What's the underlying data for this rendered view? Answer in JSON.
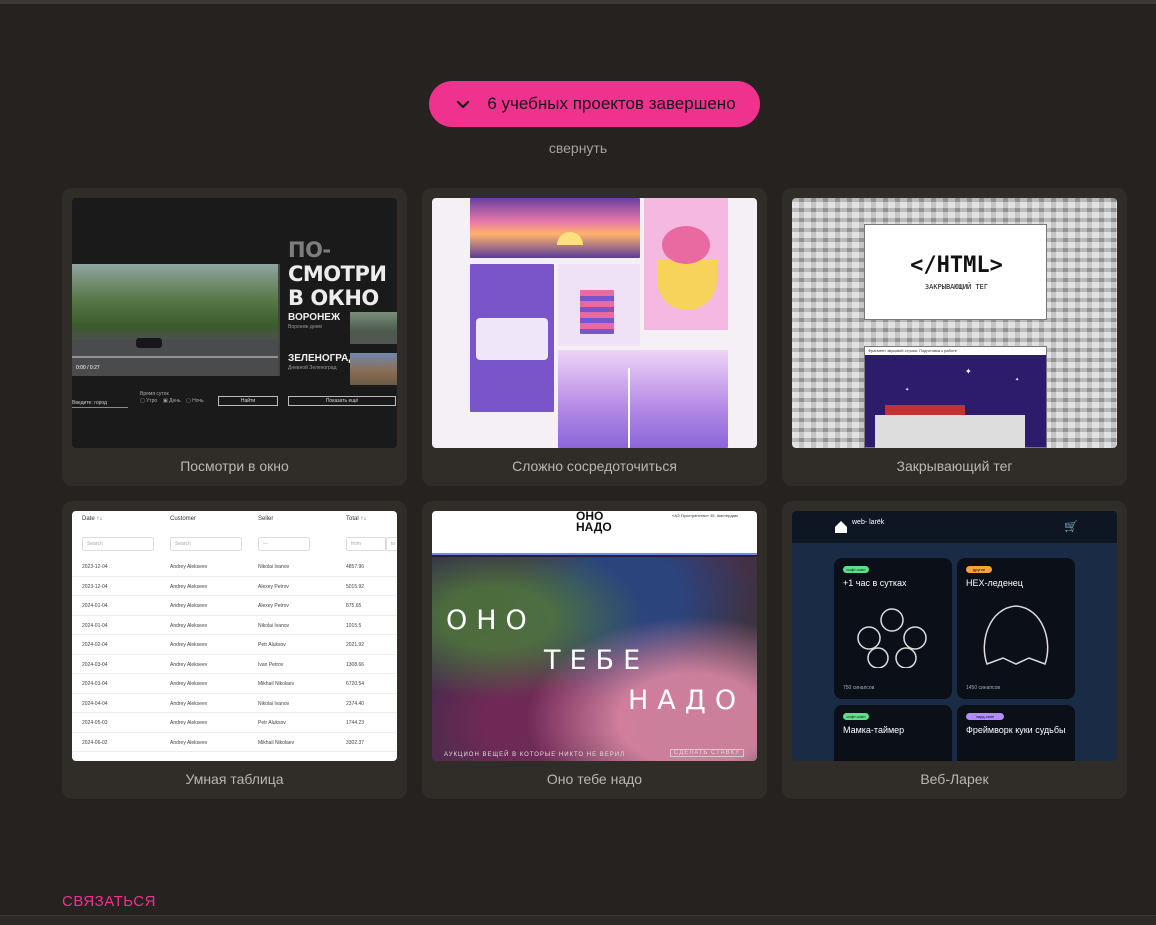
{
  "collapse_toggle": {
    "label": "6 учебных проектов завершено"
  },
  "collapse_link": "свернуть",
  "projects": [
    {
      "title": "Посмотри в окно",
      "preview": {
        "headline_dim": "ПО-",
        "headline_1": "СМОТРИ",
        "headline_2": "В ОКНО",
        "city_1": "ВОРОНЕЖ",
        "city_1_sub": "Воронеж днем",
        "city_2": "ЗЕЛЕНОГРАД...",
        "city_2_sub": "Дневной Зеленоград",
        "time": "0:00 / 0:27",
        "find_btn": "Найти",
        "show_btn": "Показать ещё",
        "input_hint": "Введите: город",
        "options": [
          "Утро",
          "День",
          "Ночь"
        ],
        "options_label": "Время суток"
      }
    },
    {
      "title": "Сложно сосредоточиться"
    },
    {
      "title": "Закрывающий тег",
      "preview": {
        "code": "</HTML>",
        "subtitle": "ЗАКРЫВАЮЩИЙ ТЕГ",
        "card_bar": "Фрагмент звуковой строки: Подготовка к работе"
      }
    },
    {
      "title": "Умная таблица",
      "preview": {
        "columns": [
          "Date ↑↓",
          "Customer",
          "Seller",
          "Total ↑↓"
        ],
        "filters": [
          "Search",
          "Search",
          "—",
          "from",
          "to"
        ],
        "rows": [
          [
            "2023-12-04",
            "Andrey Alekseev",
            "Nikolai Ivanov",
            "4857.96"
          ],
          [
            "2023-12-04",
            "Andrey Alekseev",
            "Alexey Petrov",
            "5015.92"
          ],
          [
            "2024-01-04",
            "Andrey Alekseev",
            "Alexey Petrov",
            "875.65"
          ],
          [
            "2024-01-04",
            "Andrey Alekseev",
            "Nikolai Ivanov",
            "1015.5"
          ],
          [
            "2024-02-04",
            "Andrey Alekseev",
            "Petr Aluksov",
            "2021.92"
          ],
          [
            "2024-03-04",
            "Andrey Alekseev",
            "Ivan Petrov",
            "1308.66"
          ],
          [
            "2024-03-04",
            "Andrey Alekseev",
            "Mikhail Nikolaev",
            "6720.54"
          ],
          [
            "2024-04-04",
            "Andrey Alekseev",
            "Nikolai Ivanov",
            "2374.40"
          ],
          [
            "2024-05-03",
            "Andrey Alekseev",
            "Petr Aluksov",
            "1744.23"
          ],
          [
            "2024-06-02",
            "Andrey Alekseev",
            "Mikhail Nikolaev",
            "3302.37"
          ]
        ]
      }
    },
    {
      "title": "Оно тебе надо",
      "preview": {
        "logo": "ОНО\nНАДО",
        "address": "«АЭ Пространство» 45, Амстердам",
        "word_1": "ОНО",
        "word_2": "ТЕБЕ",
        "word_3": "НАДО",
        "footer": "АУКЦИОН  ВЕЩЕЙ  В  КОТОРЫЕ  НИКТО  НЕ  ВЕРИЛ",
        "cta": "СДЕЛАТЬ СТАВКУ"
      }
    },
    {
      "title": "Веб-Ларек",
      "preview": {
        "logo": "web-\nlarёk",
        "items": [
          {
            "tag": "софт-скил",
            "title": "+1 час в сутках",
            "price": "750 синапсов",
            "tag_color": "#5ee08a"
          },
          {
            "tag": "другое",
            "title": "HEX-леденец",
            "price": "1450 синапсов",
            "tag_color": "#f4a23c"
          },
          {
            "tag": "софт-скил",
            "title": "Мамка-таймер",
            "price": "",
            "tag_color": "#5ee08a"
          },
          {
            "tag": "хард-скил",
            "title": "Фреймворк куки судьбы",
            "price": "",
            "tag_color": "#b48cff"
          }
        ]
      }
    }
  ],
  "contact_link": "СВЯЗАТЬСЯ",
  "colors": {
    "accent": "#f0328f",
    "background": "#25221f",
    "card": "#302c28"
  }
}
